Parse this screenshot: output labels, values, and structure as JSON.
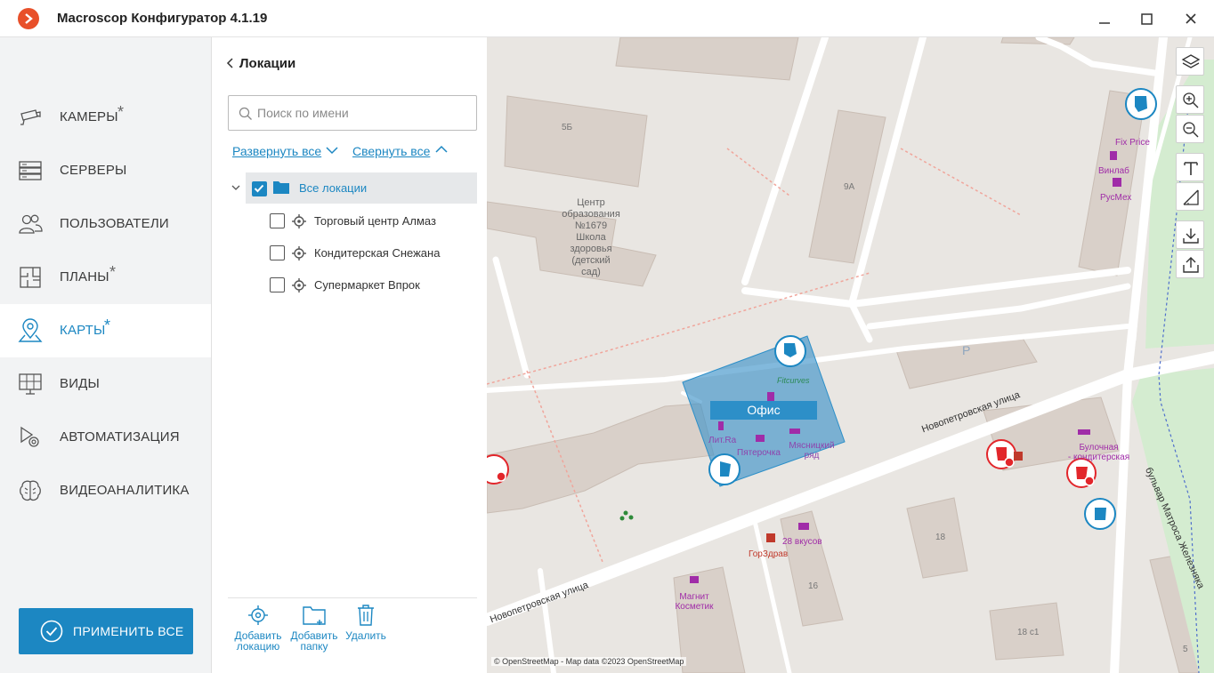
{
  "app": {
    "title": "Macroscop Конфигуратор 4.1.19",
    "accent_color": "#1c87c2",
    "logo_color": "#e8502a"
  },
  "nav": {
    "items": [
      {
        "label": "КАМЕРЫ",
        "icon": "camera-icon",
        "starred": true,
        "active": false
      },
      {
        "label": "СЕРВЕРЫ",
        "icon": "server-icon",
        "starred": false,
        "active": false
      },
      {
        "label": "ПОЛЬЗОВАТЕЛИ",
        "icon": "users-icon",
        "starred": false,
        "active": false
      },
      {
        "label": "ПЛАНЫ",
        "icon": "floorplan-icon",
        "starred": true,
        "active": false
      },
      {
        "label": "КАРТЫ",
        "icon": "map-pin-icon",
        "starred": true,
        "active": true
      },
      {
        "label": "ВИДЫ",
        "icon": "monitor-grid-icon",
        "starred": false,
        "active": false
      },
      {
        "label": "АВТОМАТИЗАЦИЯ",
        "icon": "automation-gear-icon",
        "starred": false,
        "active": false
      },
      {
        "label": "ВИДЕОАНАЛИТИКА",
        "icon": "brain-icon",
        "starred": false,
        "active": false
      }
    ],
    "star": "*",
    "apply_button": "ПРИМЕНИТЬ ВСЕ"
  },
  "panel": {
    "title": "Локации",
    "search_placeholder": "Поиск по имени",
    "search_value": "",
    "expand_all": "Развернуть все",
    "collapse_all": "Свернуть все",
    "root": {
      "label": "Все локации",
      "checked": true,
      "expanded": true
    },
    "locations": [
      {
        "label": "Торговый центр Алмаз",
        "checked": false
      },
      {
        "label": "Кондитерская Снежана",
        "checked": false
      },
      {
        "label": "Супермаркет Впрок",
        "checked": false
      }
    ],
    "toolbar": {
      "add_location_1": "Добавить",
      "add_location_2": "локацию",
      "add_folder_1": "Добавить",
      "add_folder_2": "папку",
      "delete": "Удалить"
    }
  },
  "map": {
    "attribution": "© OpenStreetMap - Map data ©2023 OpenStreetMap",
    "office_label": "Офис",
    "office_color": "#2d8fc8",
    "labels": {
      "b5b": "5Б",
      "b9a": "9А",
      "school_1": "Центр",
      "school_2": "образования",
      "school_3": "№1679",
      "school_4": "Школа",
      "school_5": "здоровья",
      "school_6": "(детский",
      "school_7": "сад)",
      "parking": "P",
      "fitcurves": "Fitcurves",
      "lit_ra": "Лит.Ra",
      "pyaterochka": "Пятерочка",
      "myasnitsky_1": "Мясницкий",
      "myasnitsky_2": "ряд",
      "street_main": "Новопетровская улица",
      "street_lower": "Новопетровская улица",
      "boulevard": "бульвар Матроса Железняка",
      "fix_price": "Fix Price",
      "vinlab": "Винлаб",
      "rusmeh": "РусМех",
      "bulochnaya_1": "Булочная",
      "bulochnaya_2": "- кондитерская",
      "b18": "18",
      "b16": "16",
      "b18c1": "18 с1",
      "b5": "5",
      "vkusov": "28 вкусов",
      "gorzdrav": "ГорЗдрав",
      "magnit_1": "Магнит",
      "magnit_2": "Косметик"
    },
    "controls": [
      "layers-icon",
      "zoom-in-icon",
      "zoom-out-icon",
      "text-tool-icon",
      "angle-tool-icon",
      "import-icon",
      "export-icon"
    ]
  }
}
